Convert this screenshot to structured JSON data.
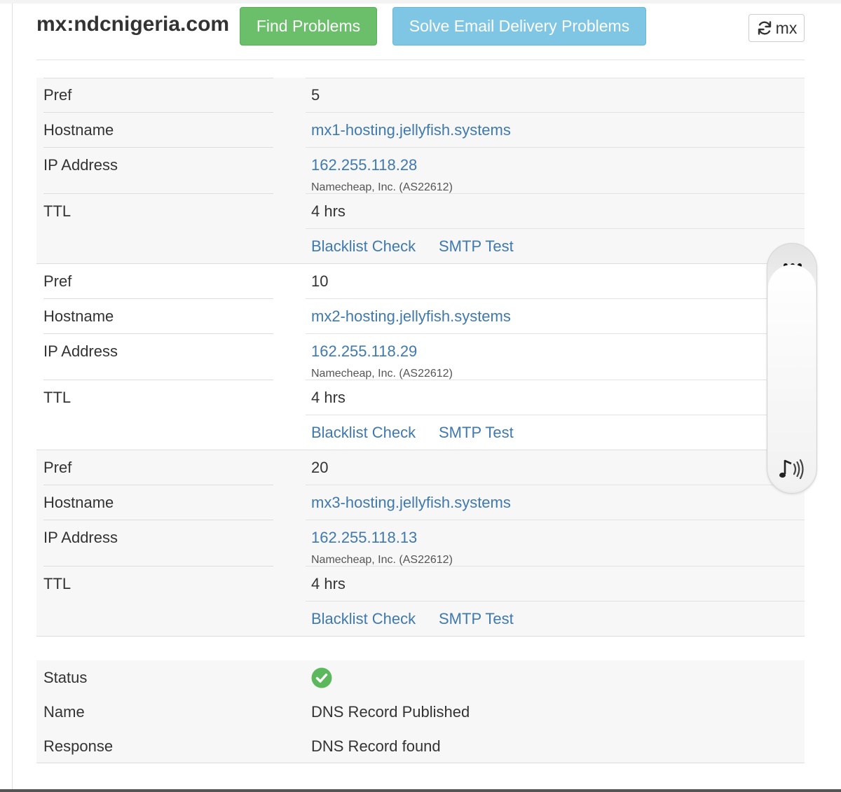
{
  "header": {
    "title": "mx:ndcnigeria.com",
    "find_label": "Find Problems",
    "solve_label": "Solve Email Delivery Problems",
    "mx_label": "mx"
  },
  "labels": {
    "pref": "Pref",
    "hostname": "Hostname",
    "ip": "IP Address",
    "ttl": "TTL"
  },
  "records": [
    {
      "pref": "5",
      "hostname": "mx1-hosting.jellyfish.systems",
      "ip": "162.255.118.28",
      "asn": "Namecheap, Inc. (AS22612)",
      "ttl": "4 hrs",
      "blacklist": "Blacklist Check",
      "smtp": "SMTP Test"
    },
    {
      "pref": "10",
      "hostname": "mx2-hosting.jellyfish.systems",
      "ip": "162.255.118.29",
      "asn": "Namecheap, Inc. (AS22612)",
      "ttl": "4 hrs",
      "blacklist": "Blacklist Check",
      "smtp": "SMTP Test"
    },
    {
      "pref": "20",
      "hostname": "mx3-hosting.jellyfish.systems",
      "ip": "162.255.118.13",
      "asn": "Namecheap, Inc. (AS22612)",
      "ttl": "4 hrs",
      "blacklist": "Blacklist Check",
      "smtp": "SMTP Test"
    }
  ],
  "status": {
    "status_label": "Status",
    "status_icon": "check-circle-icon",
    "name_label": "Name",
    "name_value": "DNS Record Published",
    "response_label": "Response",
    "response_value": "DNS Record found"
  },
  "floating_toolbar": {
    "top_icon": "more-horizontal-icon",
    "bottom_icon": "read-aloud-icon"
  },
  "colors": {
    "find_button": "#6bbf6b",
    "solve_button": "#7fc6e4",
    "link": "#3f79ad",
    "success": "#5cb85c"
  }
}
